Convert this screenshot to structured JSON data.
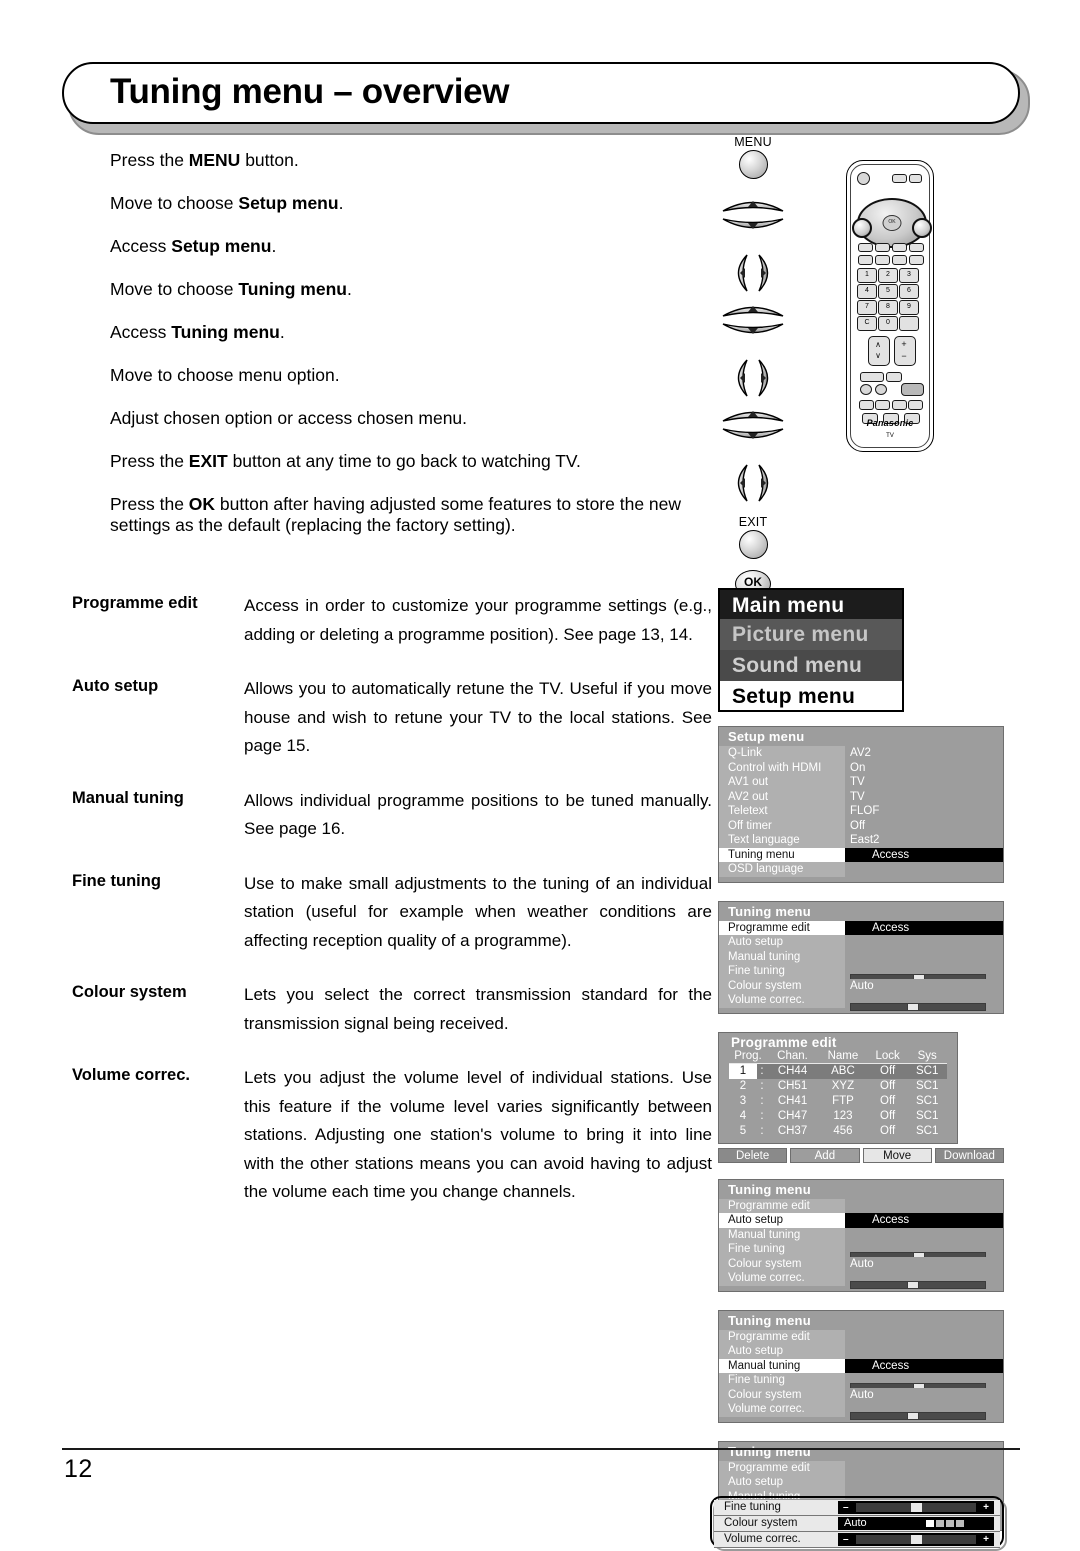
{
  "header": {
    "title": "Tuning menu – overview"
  },
  "steps": [
    {
      "parts": [
        {
          "t": "Press the ",
          "b": false
        },
        {
          "t": "MENU",
          "b": true
        },
        {
          "t": " button.",
          "b": false
        }
      ]
    },
    {
      "parts": [
        {
          "t": "Move to choose ",
          "b": false
        },
        {
          "t": "Setup menu",
          "b": true
        },
        {
          "t": ".",
          "b": false
        }
      ]
    },
    {
      "parts": [
        {
          "t": "Access ",
          "b": false
        },
        {
          "t": "Setup menu",
          "b": true
        },
        {
          "t": ".",
          "b": false
        }
      ]
    },
    {
      "parts": [
        {
          "t": "Move to choose ",
          "b": false
        },
        {
          "t": "Tuning menu",
          "b": true
        },
        {
          "t": ".",
          "b": false
        }
      ]
    },
    {
      "parts": [
        {
          "t": "Access ",
          "b": false
        },
        {
          "t": "Tuning menu",
          "b": true
        },
        {
          "t": ".",
          "b": false
        }
      ]
    },
    {
      "parts": [
        {
          "t": "Move to choose menu option.",
          "b": false
        }
      ]
    },
    {
      "parts": [
        {
          "t": "Adjust chosen option or access chosen menu.",
          "b": false
        }
      ]
    },
    {
      "parts": [
        {
          "t": "Press the ",
          "b": false
        },
        {
          "t": "EXIT",
          "b": true
        },
        {
          "t": " button at any time to go back to watching TV.",
          "b": false
        }
      ]
    },
    {
      "parts": [
        {
          "t": "Press the ",
          "b": false
        },
        {
          "t": "OK",
          "b": true
        },
        {
          "t": " button after having adjusted some features to store the new settings as the default (replacing the factory setting).",
          "b": false
        }
      ]
    }
  ],
  "remote_buttons": {
    "menu_label": "MENU",
    "exit_label": "EXIT",
    "ok_label": "OK"
  },
  "remote": {
    "brand": "Panasonic",
    "brand_sub": "TV",
    "ok_label": "OK",
    "numbers": [
      "1",
      "2",
      "3",
      "4",
      "5",
      "6",
      "7",
      "8",
      "9",
      "C",
      "0"
    ]
  },
  "features": [
    {
      "term": "Programme edit",
      "desc": "Access in order to customize your programme settings (e.g., adding or deleting a programme position). See page 13, 14."
    },
    {
      "term": "Auto setup",
      "desc": "Allows you to automatically retune the TV. Useful if you move house and wish to retune your TV to the local stations. See page 15."
    },
    {
      "term": "Manual tuning",
      "desc": "Allows individual programme positions to be tuned manually. See page 16."
    },
    {
      "term": "Fine tuning",
      "desc": "Use to make small adjustments to the tuning of an individual station (useful for example when weather conditions are affecting reception quality of a programme)."
    },
    {
      "term": "Colour system",
      "desc": "Lets you select the correct transmission standard for the transmission signal being received."
    },
    {
      "term": "Volume correc.",
      "desc": "Lets you adjust the volume level of individual stations. Use this feature if the volume level varies significantly between stations. Adjusting one station's volume to bring it into line with the other stations means you can avoid having to adjust the volume each time you change channels."
    }
  ],
  "main_menu": {
    "bars": [
      "Main menu",
      "Picture menu",
      "Sound menu",
      "Setup menu"
    ]
  },
  "setup_menu": {
    "title": "Setup menu",
    "rows": [
      {
        "label": "Q-Link",
        "value": "AV2",
        "selected": false
      },
      {
        "label": "Control with HDMI",
        "value": "On",
        "selected": false
      },
      {
        "label": "AV1 out",
        "value": "TV",
        "selected": false
      },
      {
        "label": "AV2 out",
        "value": "TV",
        "selected": false
      },
      {
        "label": "Teletext",
        "value": "FLOF",
        "selected": false
      },
      {
        "label": "Off timer",
        "value": "Off",
        "selected": false
      },
      {
        "label": "Text language",
        "value": "East2",
        "selected": false
      },
      {
        "label": "Tuning menu",
        "value": "Access",
        "selected": true
      },
      {
        "label": "OSD language",
        "value": "",
        "selected": false
      }
    ]
  },
  "tuning_menu_1": {
    "title": "Tuning menu",
    "rows": [
      {
        "label": "Programme edit",
        "value": "Access",
        "selected": true
      },
      {
        "label": "Auto setup",
        "value": "",
        "selected": false
      },
      {
        "label": "Manual tuning",
        "value": "",
        "selected": false
      },
      {
        "label": "Fine tuning",
        "value": "",
        "bar": 50,
        "selected": false
      },
      {
        "label": "Colour system",
        "value": "Auto",
        "selected": false
      },
      {
        "label": "Volume correc.",
        "value": "",
        "bar": 45,
        "selected": false
      }
    ]
  },
  "programme_edit": {
    "title": "Programme edit",
    "columns": [
      "Prog.",
      "Chan.",
      "Name",
      "Lock",
      "Sys"
    ],
    "rows": [
      {
        "prog": "1",
        "chan": "CH44",
        "name": "ABC",
        "lock": "Off",
        "sys": "SC1",
        "selected": true
      },
      {
        "prog": "2",
        "chan": "CH51",
        "name": "XYZ",
        "lock": "Off",
        "sys": "SC1",
        "selected": false
      },
      {
        "prog": "3",
        "chan": "CH41",
        "name": "FTP",
        "lock": "Off",
        "sys": "SC1",
        "selected": false
      },
      {
        "prog": "4",
        "chan": "CH47",
        "name": "123",
        "lock": "Off",
        "sys": "SC1",
        "selected": false
      },
      {
        "prog": "5",
        "chan": "CH37",
        "name": "456",
        "lock": "Off",
        "sys": "SC1",
        "selected": false
      }
    ],
    "buttons": [
      "Delete",
      "Add",
      "Move",
      "Download"
    ]
  },
  "tuning_menu_2": {
    "title": "Tuning menu",
    "rows": [
      {
        "label": "Programme edit",
        "value": "",
        "selected": false
      },
      {
        "label": "Auto setup",
        "value": "Access",
        "selected": true
      },
      {
        "label": "Manual tuning",
        "value": "",
        "selected": false
      },
      {
        "label": "Fine tuning",
        "value": "",
        "bar": 50,
        "selected": false
      },
      {
        "label": "Colour system",
        "value": "Auto",
        "selected": false
      },
      {
        "label": "Volume correc.",
        "value": "",
        "bar": 45,
        "selected": false
      }
    ]
  },
  "tuning_menu_3": {
    "title": "Tuning menu",
    "rows": [
      {
        "label": "Programme edit",
        "value": "",
        "selected": false
      },
      {
        "label": "Auto setup",
        "value": "",
        "selected": false
      },
      {
        "label": "Manual tuning",
        "value": "Access",
        "selected": true
      },
      {
        "label": "Fine tuning",
        "value": "",
        "bar": 50,
        "selected": false
      },
      {
        "label": "Colour system",
        "value": "Auto",
        "selected": false
      },
      {
        "label": "Volume correc.",
        "value": "",
        "bar": 45,
        "selected": false
      }
    ]
  },
  "tuning_menu_4": {
    "title": "Tuning menu",
    "rows": [
      {
        "label": "Programme edit",
        "value": "",
        "selected": false
      },
      {
        "label": "Auto setup",
        "value": "",
        "selected": false
      },
      {
        "label": "Manual tuning",
        "value": "",
        "selected": false
      }
    ],
    "callout_rows": [
      {
        "label": "Fine tuning",
        "value": "",
        "bar": 50,
        "minus": "–",
        "plus": "+"
      },
      {
        "label": "Colour system",
        "value": "Auto",
        "steps": 4
      },
      {
        "label": "Volume correc.",
        "value": "",
        "bar": 50,
        "minus": "–",
        "plus": "+"
      }
    ]
  },
  "footer": {
    "page_number": "12"
  }
}
